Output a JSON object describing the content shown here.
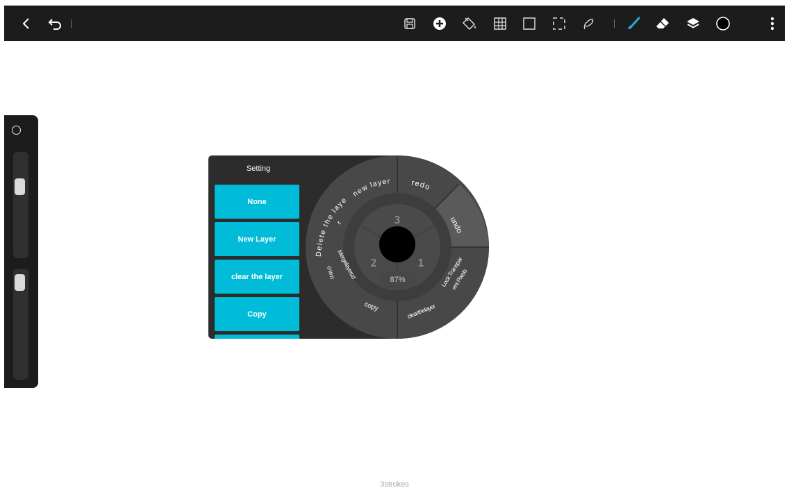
{
  "topbar": {
    "icons": [
      "back-icon",
      "undo-icon",
      "save-icon",
      "add-icon",
      "fill-bucket-icon",
      "grid-icon",
      "rectangle-select-icon",
      "dashed-select-icon",
      "lasso-icon",
      "brush-icon",
      "eraser-icon",
      "layers-icon",
      "color-circle-icon",
      "more-icon"
    ],
    "active_color": "#2aa9d9"
  },
  "popup": {
    "title": "Setting",
    "buttons": [
      "None",
      "New Layer",
      "clear the layer",
      "Copy"
    ],
    "button_color": "#00bcd8",
    "wheel_labels": {
      "delete_the_layer_1": "Delete the laye",
      "delete_the_layer_2": "r",
      "new_layer": "new layer",
      "redo": "redo",
      "undo": "undo",
      "lock_transparent_1": "Lock Transpar",
      "lock_transparent_2": "ent Pixels",
      "clear_the_layer": "clearthelayer",
      "copy": "copy",
      "merge_down_1": "Mergelayersd",
      "merge_down_2": "own"
    },
    "inner_numbers": [
      "3",
      "2",
      "1"
    ],
    "percent": "87%"
  },
  "status_text": "3strokes"
}
